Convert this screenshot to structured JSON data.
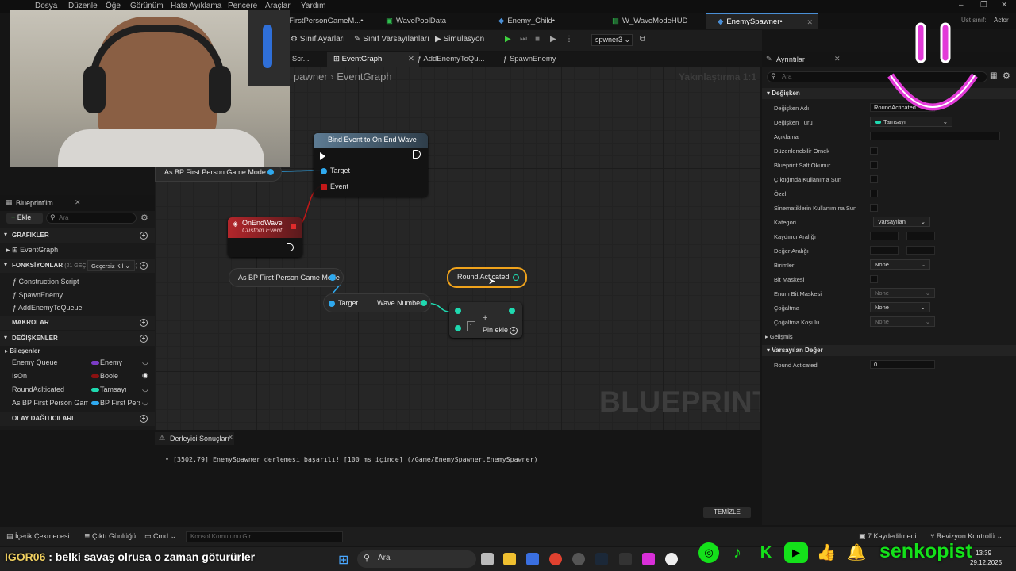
{
  "menu": [
    "Dosya",
    "Düzenle",
    "Öğe",
    "Görünüm",
    "Hata Ayıklama",
    "Pencere",
    "Araçlar",
    "Yardım"
  ],
  "parent_class": {
    "label": "Üst sınıf:",
    "value": "Actor"
  },
  "doc_tabs": [
    "FirstPersonGameM...•",
    "WavePoolData",
    "Enemy_Child•",
    "W_WaveModeHUD",
    "EnemySpawner•"
  ],
  "toolbar": {
    "class_settings": "Sınıf Ayarları",
    "class_defaults": "Sınıf Varsayılanları",
    "simulation": "Simülasyon",
    "debug_object": "spwner3"
  },
  "graph_tabs": {
    "construction": "n Scr...",
    "event_graph": "EventGraph",
    "add_enemy": "AddEnemyToQu...",
    "spawn_enemy": "SpawnEnemy"
  },
  "breadcrumb": {
    "parent": "pawner",
    "current": "EventGraph"
  },
  "zoom": "Yakınlaştırma 1:1",
  "watermark": "BLUEPRINT",
  "nodes": {
    "bind_event": {
      "title": "Bind Event to On End Wave",
      "target": "Target",
      "event": "Event"
    },
    "as_bp_top": "As BP First Person Game Mode",
    "on_end_wave": {
      "title": "OnEndWave",
      "subtitle": "Custom Event"
    },
    "as_bp_mid": "As BP First Person Game Mode",
    "wave_number": {
      "target": "Target",
      "output": "Wave Number"
    },
    "round_acticated": "Round Acticated",
    "add_pin": {
      "index": "1",
      "label": "Pin ekle"
    }
  },
  "myblueprint": {
    "title": "Blueprint'im",
    "add": "Ekle",
    "search_placeholder": "Ara",
    "graphs_header": "GRAFİKLER",
    "event_graph": "EventGraph",
    "functions_header": "FONKSİYONLAR",
    "functions_count": "(21 GEÇERSİZ KILINABİLİR)",
    "override_btn": "Geçersiz Kıl",
    "functions": [
      "Construction Script",
      "SpawnEnemy",
      "AddEnemyToQueue"
    ],
    "macros_header": "MAKROLAR",
    "variables_header": "DEĞİŞKENLER",
    "components_label": "Bileşenler",
    "variables": [
      {
        "name": "Enemy Queue",
        "type": "Enemy",
        "color": "#7b3cc6"
      },
      {
        "name": "IsOn",
        "type": "Boole",
        "color": "#8c1111"
      },
      {
        "name": "RoundAcIticated",
        "type": "Tamsayı",
        "color": "#1fd9b0"
      },
      {
        "name": "As BP First Person Game",
        "type": "BP First Pers",
        "color": "#2fa9ee"
      }
    ],
    "dispatchers_header": "OLAY DAĞITICILARI"
  },
  "details": {
    "title": "Ayrıntılar",
    "search_placeholder": "Ara",
    "variable_section": "Değişken",
    "props": [
      {
        "label": "Değişken Adı",
        "value": "RoundActicated"
      },
      {
        "label": "Değişken Türü",
        "value": "Tamsayı"
      },
      {
        "label": "Açıklama",
        "value": ""
      },
      {
        "label": "Düzenlenebilir Örnek",
        "value": ""
      },
      {
        "label": "Blueprint Salt Okunur",
        "value": ""
      },
      {
        "label": "Çıktığında Kullanıma Sun",
        "value": ""
      },
      {
        "label": "Özel",
        "value": ""
      },
      {
        "label": "Sinematiklerin Kullanımına Sun",
        "value": ""
      },
      {
        "label": "Kategori",
        "value": "Varsayılan"
      },
      {
        "label": "Kaydırıcı Aralığı",
        "value": ""
      },
      {
        "label": "Değer Aralığı",
        "value": ""
      },
      {
        "label": "Birimler",
        "value": "None"
      },
      {
        "label": "Bit Maskesi",
        "value": ""
      },
      {
        "label": "Enum Bit Maskesi",
        "value": "None"
      },
      {
        "label": "Çoğaltma",
        "value": "None"
      },
      {
        "label": "Çoğaltma Koşulu",
        "value": "None"
      }
    ],
    "advanced": "Gelişmiş",
    "default_section": "Varsayılan Değer",
    "default_label": "Round Acticated",
    "default_value": "0"
  },
  "compiler": {
    "title": "Derleyici Sonuçları",
    "message": "[3502,79] EnemySpawner derlemesi başarılı! [100 ms içinde] (/Game/EnemySpawner.EnemySpawner)",
    "clear": "TEMİZLE"
  },
  "statusbar": {
    "content_drawer": "İçerik Çekmecesi",
    "output_log": "Çıktı Günlüğü",
    "cmd": "Cmd",
    "console_placeholder": "Konsol Komutunu Gir",
    "saved": "7 Kaydedilmedi",
    "revision": "Revizyon Kontrolü"
  },
  "chat": {
    "user": "IGOR06",
    "message": " : belki savaş olrusa o zaman göturürler"
  },
  "taskbar": {
    "search": "Ara",
    "time": "13:39",
    "date": "29.12.2025"
  },
  "social_handle": "senkopist"
}
